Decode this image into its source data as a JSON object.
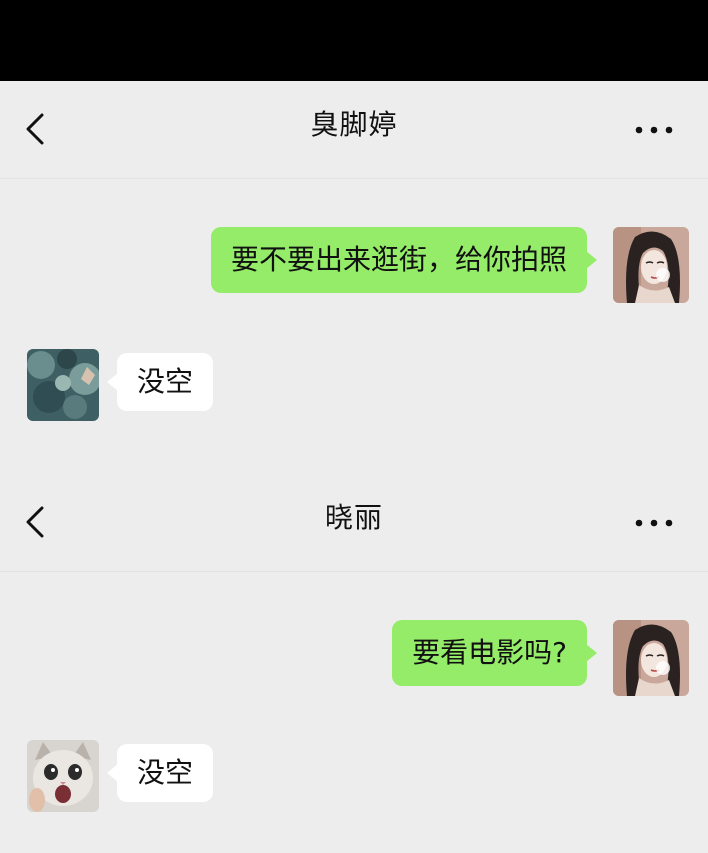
{
  "chats": [
    {
      "header": {
        "title": "臭脚婷",
        "back_icon": "chevron-left-icon",
        "more_icon": "more-dots-icon"
      },
      "messages": [
        {
          "direction": "outgoing",
          "text": "要不要出来逛街，给你拍照",
          "avatar": "girl-sketch-avatar"
        },
        {
          "direction": "incoming",
          "text": "没空",
          "avatar": "teal-painting-avatar"
        }
      ]
    },
    {
      "header": {
        "title": "晓丽",
        "back_icon": "chevron-left-icon",
        "more_icon": "more-dots-icon"
      },
      "messages": [
        {
          "direction": "outgoing",
          "text": "要看电影吗?",
          "avatar": "girl-sketch-avatar"
        },
        {
          "direction": "incoming",
          "text": "没空",
          "avatar": "shocked-kitten-avatar"
        }
      ]
    }
  ],
  "colors": {
    "outgoing_bubble": "#95ec69",
    "incoming_bubble": "#ffffff",
    "background": "#ededed",
    "status_bar": "#000000"
  }
}
